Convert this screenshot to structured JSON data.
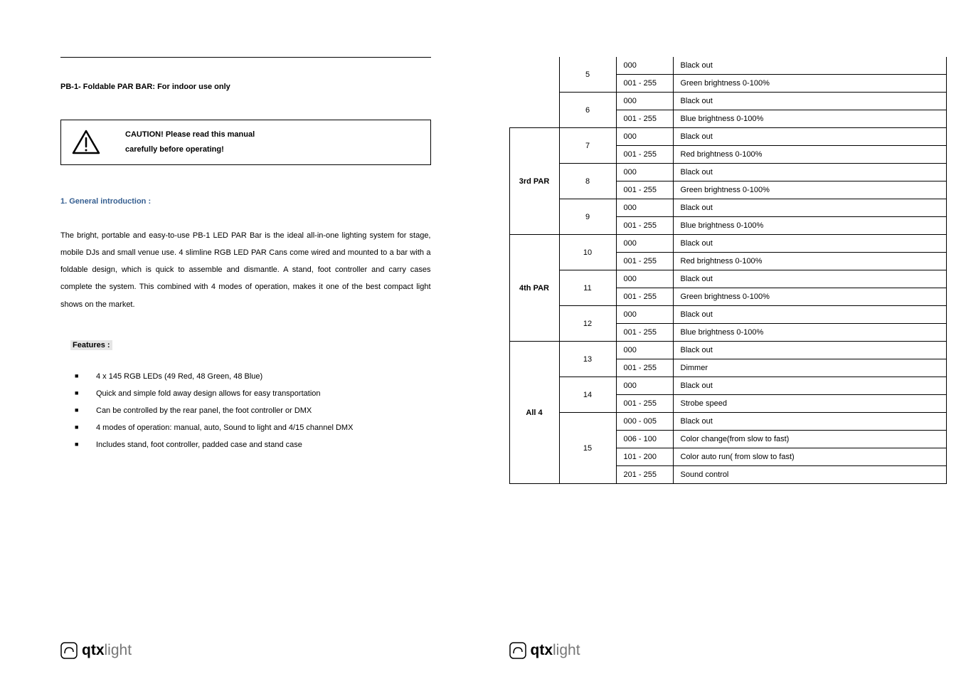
{
  "title": "PB-1- Foldable PAR BAR: For indoor use only",
  "caution": {
    "line1": "CAUTION! Please read this manual",
    "line2": "carefully before operating!"
  },
  "section1": {
    "heading": "1.    General introduction :",
    "intro": "The bright, portable and easy-to-use PB-1 LED PAR Bar is the ideal all-in-one lighting system for stage, mobile DJs and small venue use. 4 slimline RGB LED PAR Cans come wired and mounted to a bar with a foldable design, which is quick to assemble and dismantle. A stand, foot controller and carry cases complete the system. This combined with 4 modes of operation, makes it one of the best compact light shows on the market."
  },
  "features": {
    "label": "Features :",
    "items": [
      "4 x 145 RGB LEDs (49 Red, 48 Green, 48 Blue)",
      "Quick and simple fold away design allows for easy transportation",
      "Can be controlled by the rear panel, the foot controller or DMX",
      "4 modes of operation: manual, auto, Sound to light and 4/15 channel DMX",
      "Includes stand, foot controller, padded case and stand case"
    ]
  },
  "logo": {
    "qtx": "qtx",
    "light": "light"
  },
  "dmx": {
    "groups": [
      {
        "label": "",
        "channels": [
          {
            "num": "5",
            "rows": [
              [
                "000",
                "Black out"
              ],
              [
                "001 - 255",
                "Green brightness 0-100%"
              ]
            ]
          },
          {
            "num": "6",
            "rows": [
              [
                "000",
                "Black out"
              ],
              [
                "001 - 255",
                "Blue brightness 0-100%"
              ]
            ]
          }
        ]
      },
      {
        "label": "3rd PAR",
        "channels": [
          {
            "num": "7",
            "rows": [
              [
                "000",
                "Black out"
              ],
              [
                "001 - 255",
                "Red brightness 0-100%"
              ]
            ]
          },
          {
            "num": "8",
            "rows": [
              [
                "000",
                "Black out"
              ],
              [
                "001 - 255",
                "Green brightness 0-100%"
              ]
            ]
          },
          {
            "num": "9",
            "rows": [
              [
                "000",
                "Black out"
              ],
              [
                "001 - 255",
                "Blue brightness 0-100%"
              ]
            ]
          }
        ]
      },
      {
        "label": "4th PAR",
        "channels": [
          {
            "num": "10",
            "rows": [
              [
                "000",
                "Black out"
              ],
              [
                "001 - 255",
                "Red brightness 0-100%"
              ]
            ]
          },
          {
            "num": "11",
            "rows": [
              [
                "000",
                "Black out"
              ],
              [
                "001 - 255",
                "Green brightness 0-100%"
              ]
            ]
          },
          {
            "num": "12",
            "rows": [
              [
                "000",
                "Black out"
              ],
              [
                "001 - 255",
                "Blue brightness 0-100%"
              ]
            ]
          }
        ]
      },
      {
        "label": "All 4",
        "channels": [
          {
            "num": "13",
            "rows": [
              [
                "000",
                "Black out"
              ],
              [
                "001 - 255",
                "Dimmer"
              ]
            ]
          },
          {
            "num": "14",
            "rows": [
              [
                "000",
                "Black out"
              ],
              [
                "001 - 255",
                "Strobe speed"
              ]
            ]
          },
          {
            "num": "15",
            "rows": [
              [
                "000 - 005",
                "Black out"
              ],
              [
                "006 - 100",
                "Color change(from slow to fast)"
              ],
              [
                "101 - 200",
                "Color auto run( from slow to fast)"
              ],
              [
                "201 - 255",
                "Sound control"
              ]
            ]
          }
        ]
      }
    ]
  }
}
